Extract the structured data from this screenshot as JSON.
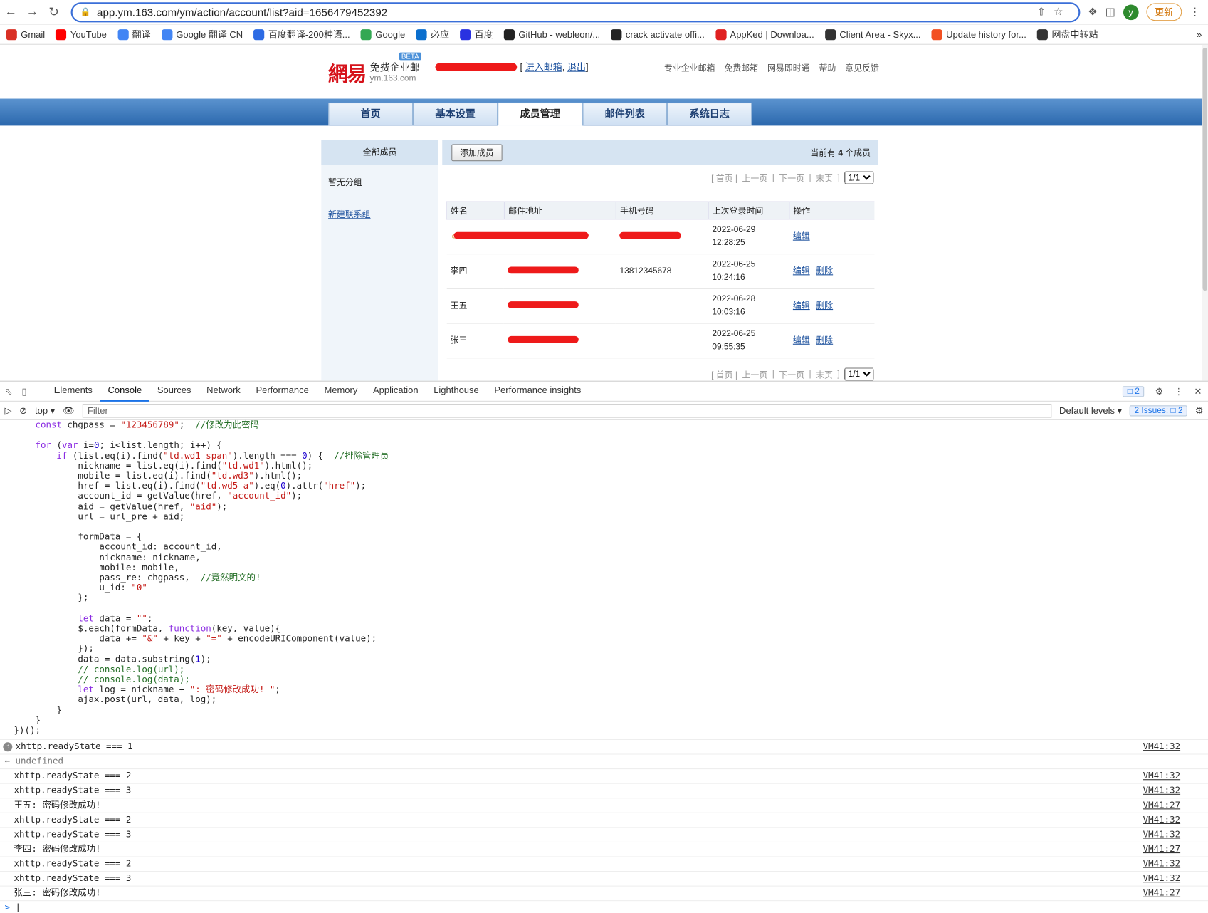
{
  "browser": {
    "url": "app.ym.163.com/ym/action/account/list?aid=1656479452392",
    "update_label": "更新",
    "avatar_letter": "y",
    "bookmarks": [
      {
        "label": "Gmail",
        "color": "#d93025"
      },
      {
        "label": "YouTube",
        "color": "#ff0000"
      },
      {
        "label": "翻译",
        "color": "#4285f4"
      },
      {
        "label": "Google 翻译 CN",
        "color": "#4285f4"
      },
      {
        "label": "百度翻译-200种语...",
        "color": "#2d6be4"
      },
      {
        "label": "Google",
        "color": "#34a853"
      },
      {
        "label": "必应",
        "color": "#0b6fce"
      },
      {
        "label": "百度",
        "color": "#2932e1"
      },
      {
        "label": "GitHub - webleon/...",
        "color": "#222"
      },
      {
        "label": "crack activate offi...",
        "color": "#222"
      },
      {
        "label": "AppKed | Downloa...",
        "color": "#e02020"
      },
      {
        "label": "Client Area - Skyx...",
        "color": "#333"
      },
      {
        "label": "Update history for...",
        "color": "#f25022"
      },
      {
        "label": "网盘中转站",
        "color": "#333"
      }
    ]
  },
  "page": {
    "logo_mark": "網易",
    "logo_title": "免费企业邮",
    "logo_domain": "ym.163.com",
    "beta": "BETA",
    "user_links": {
      "enter": "进入邮箱",
      "logout": "退出"
    },
    "top_links": [
      "专业企业邮箱",
      "免费邮箱",
      "网易即时通",
      "帮助",
      "意见反馈"
    ],
    "tabs": [
      "首页",
      "基本设置",
      "成员管理",
      "邮件列表",
      "系统日志"
    ],
    "sidebar": {
      "head": "全部成员",
      "no_group": "暂无分组",
      "new_group": "新建联系组"
    },
    "add_member": "添加成员",
    "member_count_prefix": "当前有",
    "member_count": "4",
    "member_count_suffix": "个成员",
    "pager": {
      "first": "首页",
      "prev": "上一页",
      "next": "下一页",
      "last": "末页",
      "page": "1/1"
    },
    "columns": [
      "姓名",
      "邮件地址",
      "手机号码",
      "上次登录时间",
      "操作"
    ],
    "rows": [
      {
        "name": "",
        "mobile": "",
        "date": "2022-06-29",
        "time": "12:28:25",
        "edit": "编辑",
        "del": ""
      },
      {
        "name": "李四",
        "mobile": "13812345678",
        "date": "2022-06-25",
        "time": "10:24:16",
        "edit": "编辑",
        "del": "删除"
      },
      {
        "name": "王五",
        "mobile": "",
        "date": "2022-06-28",
        "time": "10:03:16",
        "edit": "编辑",
        "del": "删除"
      },
      {
        "name": "张三",
        "mobile": "",
        "date": "2022-06-25",
        "time": "09:55:35",
        "edit": "编辑",
        "del": "删除"
      }
    ]
  },
  "devtools": {
    "tabs": [
      "Elements",
      "Console",
      "Sources",
      "Network",
      "Performance",
      "Memory",
      "Application",
      "Lighthouse",
      "Performance insights"
    ],
    "active_tab": "Console",
    "issues_badge": "2",
    "context": "top",
    "filter_placeholder": "Filter",
    "levels": "Default levels",
    "issues_label": "2 Issues:",
    "issues_count": "2"
  },
  "console": {
    "logs": [
      {
        "text": "xhttp.readyState === 1",
        "src": "VM41:32",
        "count": "3"
      },
      {
        "text": "undefined",
        "src": "",
        "ret": true
      },
      {
        "text": "xhttp.readyState === 2",
        "src": "VM41:32"
      },
      {
        "text": "xhttp.readyState === 3",
        "src": "VM41:32"
      },
      {
        "text": "王五: 密码修改成功!",
        "src": "VM41:27"
      },
      {
        "text": "xhttp.readyState === 2",
        "src": "VM41:32"
      },
      {
        "text": "xhttp.readyState === 3",
        "src": "VM41:32"
      },
      {
        "text": "李四: 密码修改成功!",
        "src": "VM41:27"
      },
      {
        "text": "xhttp.readyState === 2",
        "src": "VM41:32"
      },
      {
        "text": "xhttp.readyState === 3",
        "src": "VM41:32"
      },
      {
        "text": "张三: 密码修改成功!",
        "src": "VM41:27"
      }
    ]
  }
}
